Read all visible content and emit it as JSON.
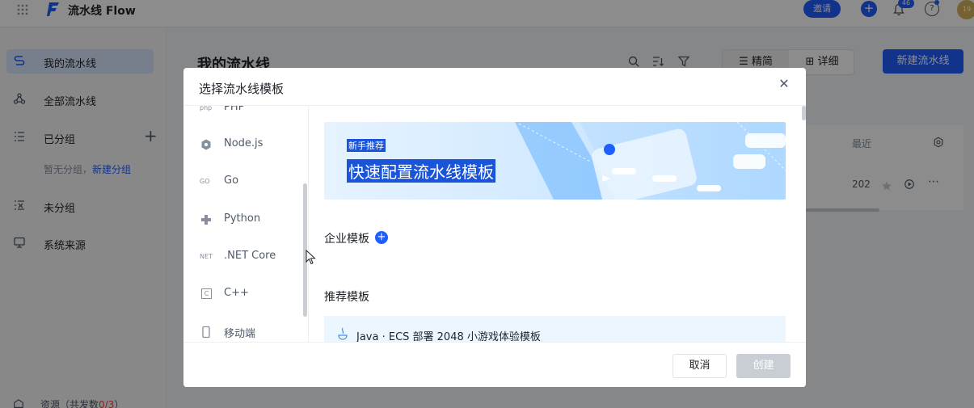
{
  "app": {
    "name": "流水线 Flow"
  },
  "topbar": {
    "invite_label": "邀请",
    "notification_count": "46",
    "avatar_text": "19"
  },
  "sidebar": {
    "items": [
      {
        "label": "我的流水线",
        "icon": "pipeline-icon",
        "active": true
      },
      {
        "label": "全部流水线",
        "icon": "flow-nodes-icon"
      },
      {
        "label": "已分组",
        "icon": "group-list-icon"
      },
      {
        "label": "未分组",
        "icon": "ungrouped-icon"
      },
      {
        "label": "系统来源",
        "icon": "monitor-icon"
      }
    ],
    "empty_group_text": "暂无分组，",
    "new_group_link": "新建分组",
    "bottom_label": "资源（共发数",
    "bottom_count": "0/3",
    "bottom_suffix": "）"
  },
  "main": {
    "title": "我的流水线",
    "view_simple": "精简",
    "view_detail": "详细",
    "new_pipeline": "新建流水线",
    "table_header": "最近",
    "table_cell": "202"
  },
  "modal": {
    "title": "选择流水线模板",
    "languages": [
      {
        "label": "PHP",
        "icon": "php-icon",
        "icon_text": "php"
      },
      {
        "label": "Node.js",
        "icon": "nodejs-icon",
        "icon_text": ""
      },
      {
        "label": "Go",
        "icon": "go-icon",
        "icon_text": "GO"
      },
      {
        "label": "Python",
        "icon": "python-icon",
        "icon_text": ""
      },
      {
        "label": ".NET Core",
        "icon": "dotnet-icon",
        "icon_text": "NET"
      },
      {
        "label": "C++",
        "icon": "cpp-icon",
        "icon_text": "C"
      },
      {
        "label": "移动端",
        "icon": "mobile-icon",
        "icon_text": ""
      }
    ],
    "banner_tag": "新手推荐",
    "banner_title": "快速配置流水线模板",
    "enterprise_label": "企业模板",
    "recommended_label": "推荐模板",
    "template_item": "Java · ECS 部署 2048 小游戏体验模板",
    "cancel": "取消",
    "create": "创建"
  },
  "colors": {
    "accent": "#1f5eff",
    "overlay": "rgba(0,0,0,0.45)",
    "banner_highlight": "#1a54d8",
    "disabled": "#c9cdd4"
  }
}
